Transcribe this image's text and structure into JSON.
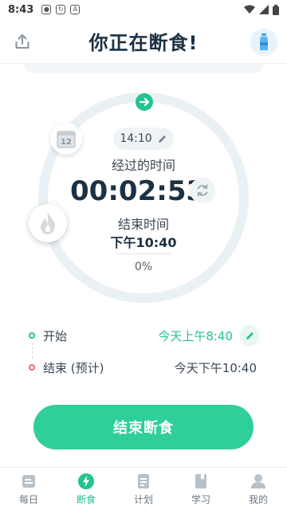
{
  "status_bar": {
    "time": "8:43"
  },
  "header": {
    "title": "你正在断食!"
  },
  "timer_card": {
    "start_chip": "14:10",
    "elapsed_label": "经过的时间",
    "elapsed_value": "00:02:53",
    "end_label": "结束时间",
    "end_time": "下午10:40",
    "progress_percent": "0%",
    "progress_fraction": 0.0,
    "badge_hours": "12"
  },
  "schedule": {
    "start_label": "开始",
    "start_value": "今天上午8:40",
    "end_label": "结束 (预计)",
    "end_value": "今天下午10:40"
  },
  "primary_button": {
    "label": "结束断食"
  },
  "colors": {
    "accent": "#22c48f",
    "button": "#2fcf98",
    "ring": "#eaf1f5",
    "end_dot": "#e96a6a"
  },
  "nav": {
    "items": [
      {
        "label": "每日",
        "icon": "daily-icon"
      },
      {
        "label": "断食",
        "icon": "lightning-icon"
      },
      {
        "label": "计划",
        "icon": "plan-icon"
      },
      {
        "label": "学习",
        "icon": "book-icon"
      },
      {
        "label": "我的",
        "icon": "profile-icon"
      }
    ],
    "active_index": 1
  }
}
